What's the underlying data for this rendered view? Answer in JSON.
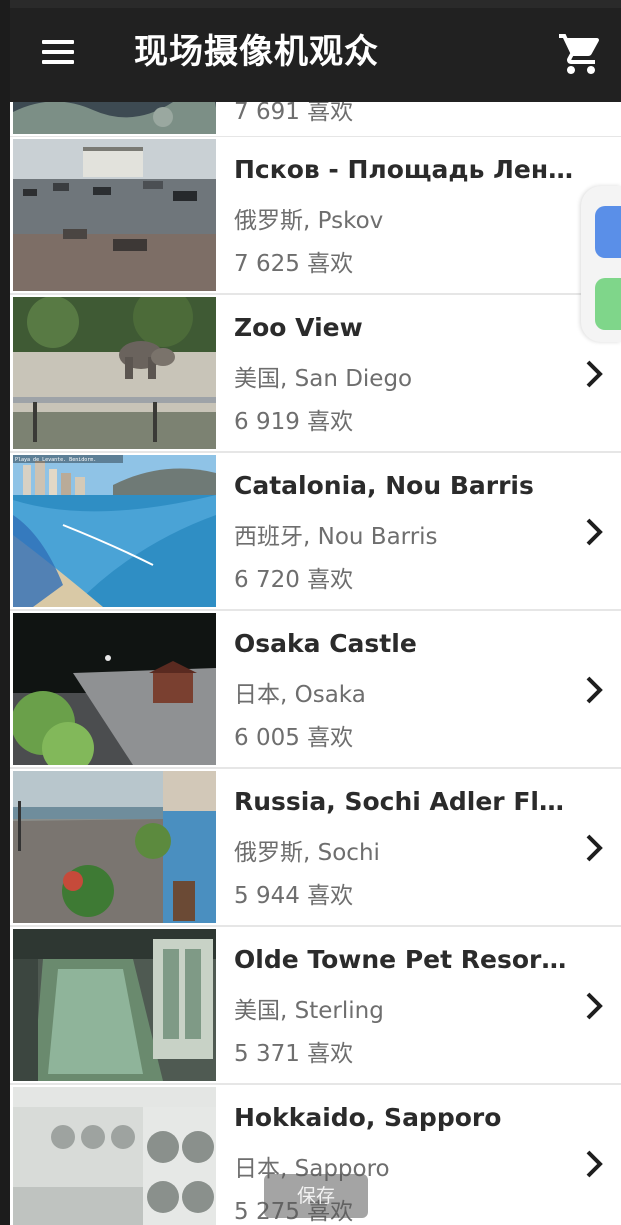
{
  "app_bar": {
    "title": "现场摄像机观众",
    "menu_icon": "hamburger-menu-icon",
    "cart_icon": "shopping-cart-icon"
  },
  "partial_top_row": {
    "likes": "7 691 喜欢"
  },
  "cameras": [
    {
      "title": "Псков - Площадь Ленина",
      "location": "俄罗斯, Pskov",
      "likes": "7 625 喜欢"
    },
    {
      "title": "Zoo View",
      "location": "美国, San Diego",
      "likes": "6 919 喜欢"
    },
    {
      "title": "Catalonia, Nou Barris",
      "location": "西班牙, Nou Barris",
      "likes": "6 720 喜欢",
      "thumb_caption": "Playa de Levante. Benidorm."
    },
    {
      "title": "Osaka Castle",
      "location": "日本, Osaka",
      "likes": "6 005 喜欢"
    },
    {
      "title": "Russia, Sochi Adler Flami…",
      "location": "俄罗斯, Sochi",
      "likes": "5 944 喜欢"
    },
    {
      "title": "Olde Towne Pet Resort, S…",
      "location": "美国, Sterling",
      "likes": "5 371 喜欢"
    },
    {
      "title": "Hokkaido, Sapporo",
      "location": "日本, Sapporo",
      "likes": "5 275 喜欢"
    }
  ],
  "toast": {
    "text": "保存"
  },
  "colors": {
    "app_bar": "#212121",
    "title_text": "#2b2b2b",
    "secondary_text": "#6e6e6e",
    "float_blue": "#5a8fe8",
    "float_green": "#7fd68a"
  }
}
